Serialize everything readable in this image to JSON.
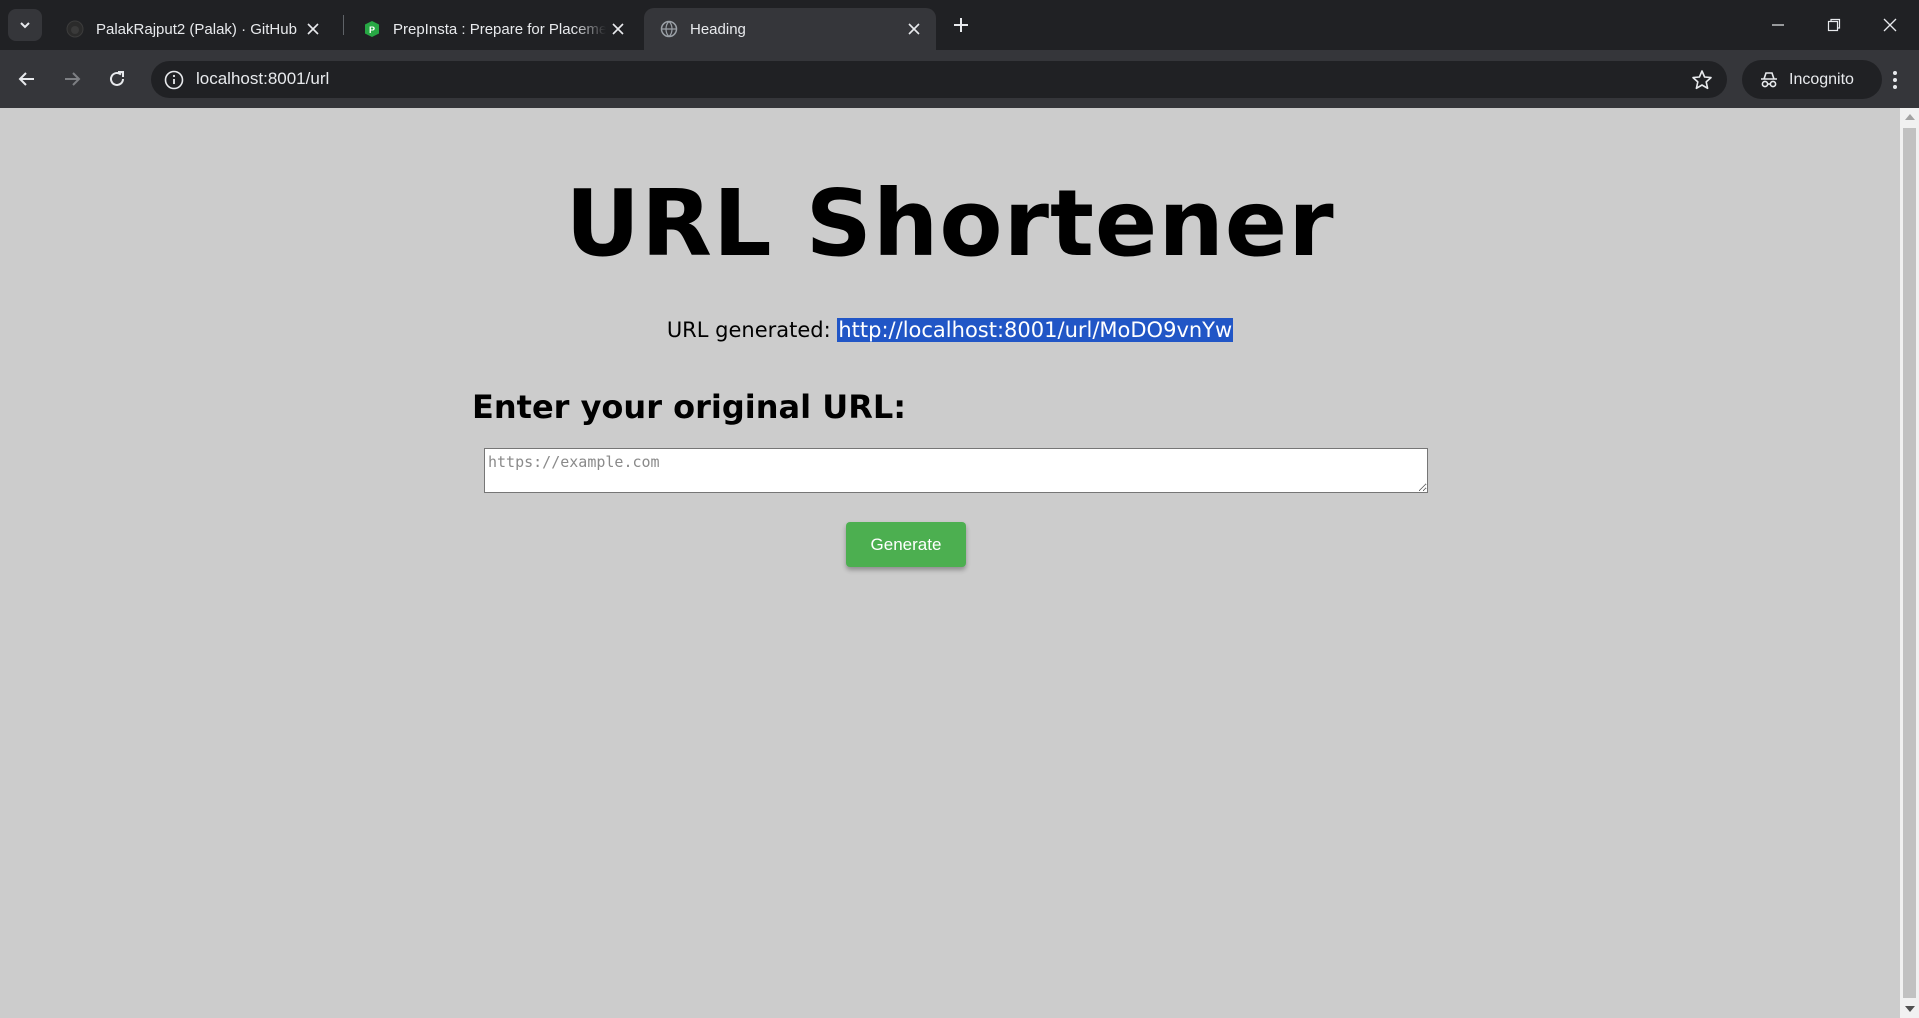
{
  "browser": {
    "tabs": [
      {
        "title": "PalakRajput2 (Palak) · GitHub",
        "favicon": "github-icon"
      },
      {
        "title": "PrepInsta : Prepare for Placements",
        "favicon": "prepinsta-icon"
      },
      {
        "title": "Heading",
        "favicon": "globe-icon",
        "active": true
      }
    ],
    "address": "localhost:8001/url",
    "profile_label": "Incognito"
  },
  "page": {
    "title": "URL Shortener",
    "generated_label": "URL generated: ",
    "generated_url": "http://localhost:8001/url/MoDO9vnYw",
    "form_heading": "Enter your original URL:",
    "input_placeholder": "https://example.com",
    "input_value": "",
    "button_label": "Generate"
  },
  "colors": {
    "page_background": "#cccccc",
    "button_green": "#4caf50",
    "selection_blue": "#2156c6"
  }
}
